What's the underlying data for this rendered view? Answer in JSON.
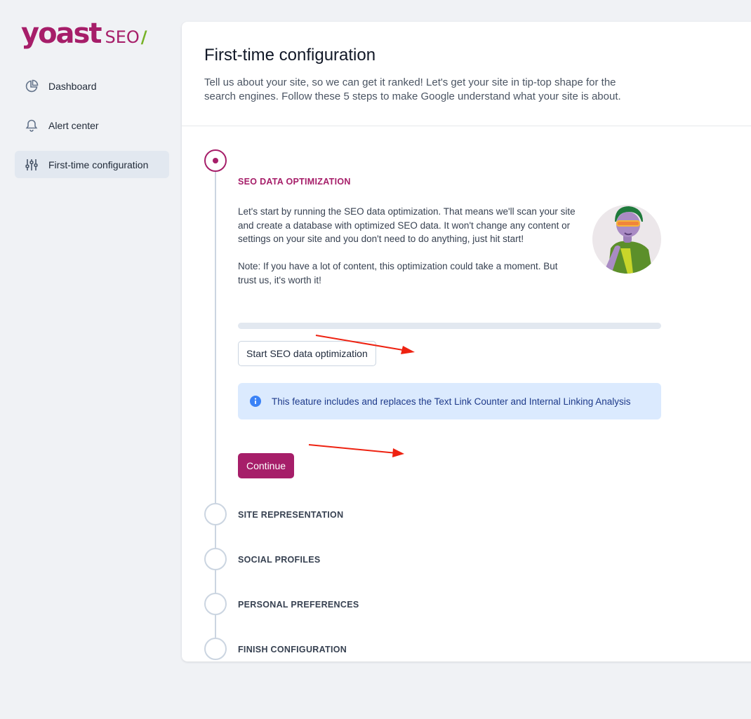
{
  "brand": {
    "name": "yoast",
    "product": "SEO",
    "primary_color": "#a61e69",
    "accent_color": "#77b227"
  },
  "sidebar": {
    "items": [
      {
        "label": "Dashboard",
        "icon": "pie-chart-icon",
        "active": false
      },
      {
        "label": "Alert center",
        "icon": "bell-icon",
        "active": false
      },
      {
        "label": "First-time configuration",
        "icon": "sliders-icon",
        "active": true
      }
    ]
  },
  "header": {
    "title": "First-time configuration",
    "description": "Tell us about your site, so we can get it ranked! Let's get your site in tip-top shape for the search engines. Follow these 5 steps to make Google understand what your site is about."
  },
  "steps": [
    {
      "title": "SEO DATA OPTIMIZATION",
      "status": "active"
    },
    {
      "title": "SITE REPRESENTATION",
      "status": "pending"
    },
    {
      "title": "SOCIAL PROFILES",
      "status": "pending"
    },
    {
      "title": "PERSONAL PREFERENCES",
      "status": "pending"
    },
    {
      "title": "FINISH CONFIGURATION",
      "status": "pending"
    }
  ],
  "active_step": {
    "paragraph1": "Let's start by running the SEO data optimization. That means we'll scan your site and create a database with optimized SEO data. It won't change any content or settings on your site and you don't need to do anything, just hit start!",
    "paragraph2": "Note: If you have a lot of content, this optimization could take a moment. But trust us, it's worth it!",
    "progress_fraction": 0,
    "start_button": "Start SEO data optimization",
    "info_icon": "info-circle-icon",
    "info_text": "This feature includes and replaces the Text Link Counter and Internal Linking Analysis",
    "continue_button": "Continue"
  },
  "annotations": {
    "arrow_color": "#ee2211"
  }
}
